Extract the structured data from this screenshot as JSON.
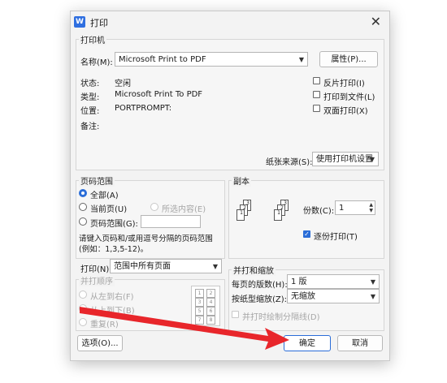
{
  "dialog": {
    "title": "打印",
    "app_icon_letter": "W",
    "close_glyph": "✕"
  },
  "printer": {
    "group_label": "打印机",
    "name_label": "名称(M):",
    "name_value": "Microsoft Print to PDF",
    "properties_button": "属性(P)...",
    "status_label": "状态:",
    "status_value": "空闲",
    "type_label": "类型:",
    "type_value": "Microsoft Print To PDF",
    "location_label": "位置:",
    "location_value": "PORTPROMPT:",
    "comment_label": "备注:",
    "reverse_print": "反片打印(I)",
    "print_to_file": "打印到文件(L)",
    "duplex": "双面打印(X)",
    "paper_source_label": "纸张来源(S):",
    "paper_source_value": "使用打印机设置"
  },
  "page_range": {
    "group_label": "页码范围",
    "all": "全部(A)",
    "current": "当前页(U)",
    "selection": "所选内容(E)",
    "pages": "页码范围(G):",
    "hint_line1": "请键入页码和/或用逗号分隔的页码范围",
    "hint_line2": "(例如：1,3,5-12)。"
  },
  "copies": {
    "group_label": "副本",
    "count_label": "份数(C):",
    "count_value": "1",
    "collate": "逐份打印(T)"
  },
  "print_what": {
    "label": "打印(N):",
    "value": "范围中所有页面"
  },
  "order": {
    "group_label": "并打顺序",
    "left_to_right": "从左到右(F)",
    "top_to_bottom": "从上到下(B)",
    "repeat": "重复(R)",
    "grid_numbers": [
      "1",
      "2",
      "3",
      "4",
      "5",
      "6",
      "7",
      "8"
    ]
  },
  "zoom": {
    "group_label": "并打和缩放",
    "pages_per_sheet_label": "每页的版数(H):",
    "pages_per_sheet_value": "1 版",
    "scale_label": "按纸型缩放(Z):",
    "scale_value": "无缩放",
    "draw_borders": "并打时绘制分隔线(D)"
  },
  "footer": {
    "options_button": "选项(O)...",
    "ok_button": "确定",
    "cancel_button": "取消"
  },
  "colors": {
    "accent": "#2a6dd8",
    "annotation_arrow": "#e8262b"
  }
}
